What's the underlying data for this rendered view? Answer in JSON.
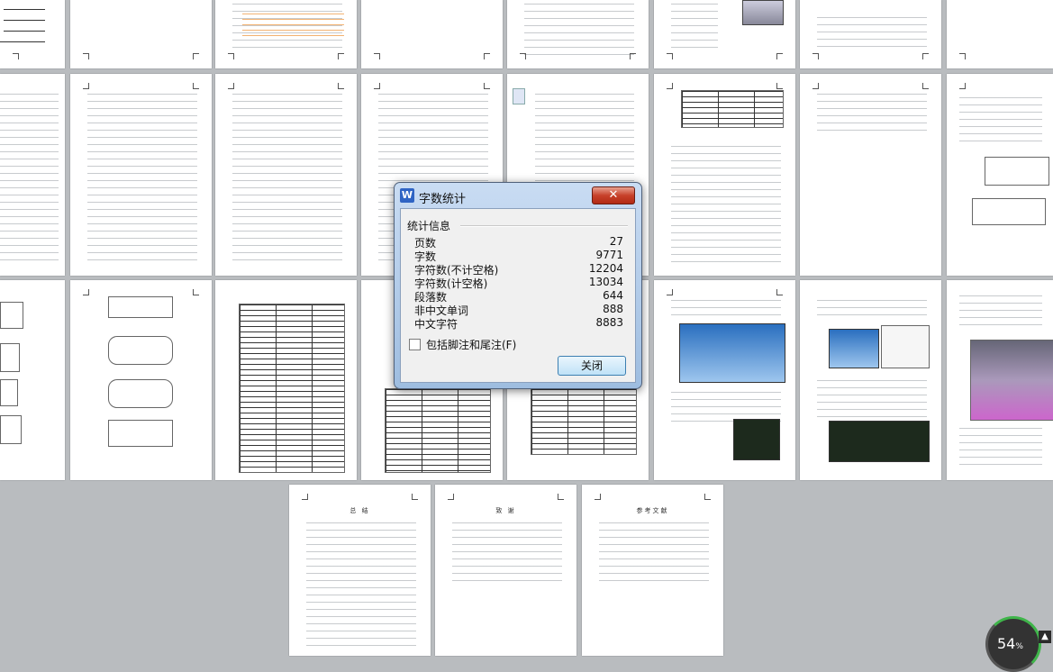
{
  "dialog": {
    "title": "字数统计",
    "close_symbol": "✕",
    "group_label": "统计信息",
    "stats": [
      {
        "label": "页数",
        "value": "27"
      },
      {
        "label": "字数",
        "value": "9771"
      },
      {
        "label": "字符数(不计空格)",
        "value": "12204"
      },
      {
        "label": "字符数(计空格)",
        "value": "13034"
      },
      {
        "label": "段落数",
        "value": "644"
      },
      {
        "label": "非中文单词",
        "value": "888"
      },
      {
        "label": "中文字符",
        "value": "8883"
      }
    ],
    "include_footnotes_label": "包括脚注和尾注(F)",
    "close_button": "关闭"
  },
  "pages": {
    "summary_title": "总 结",
    "thanks_title": "致 谢",
    "references_title": "参考文献"
  },
  "status": {
    "gauge_value": "54",
    "gauge_unit": "%",
    "up_icon": "arrow-up-icon"
  }
}
